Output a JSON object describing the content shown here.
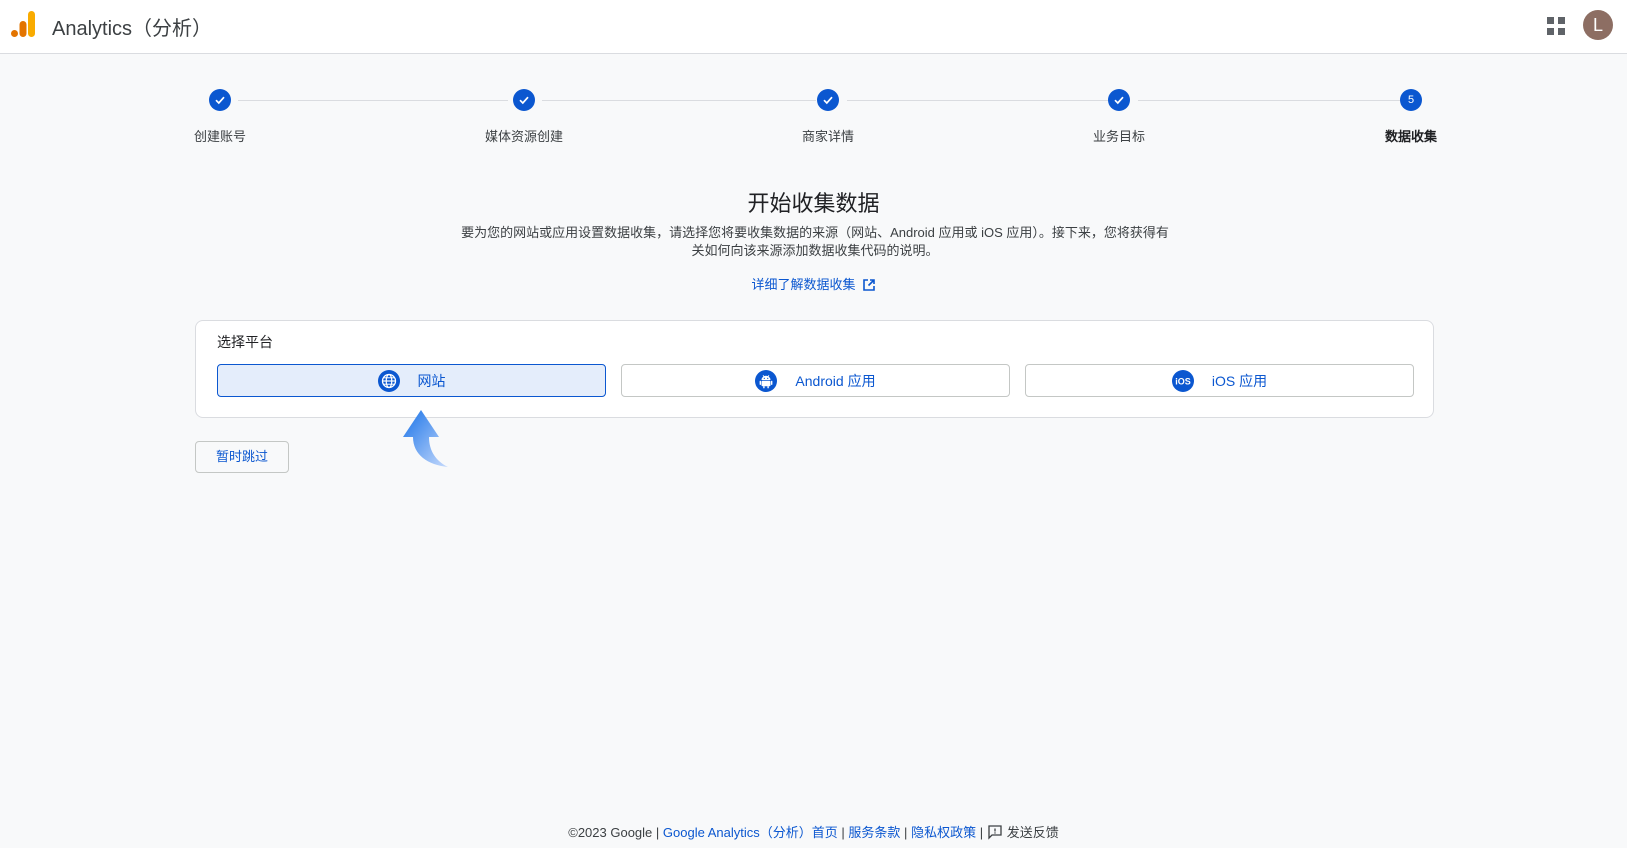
{
  "header": {
    "app_title": "Analytics（分析）",
    "avatar_initial": "L",
    "brand_colors": {
      "bar_orange": "#f9ab00",
      "bar_dark_orange": "#e37400"
    }
  },
  "stepper": {
    "steps": [
      {
        "label": "创建账号",
        "status": "done"
      },
      {
        "label": "媒体资源创建",
        "status": "done"
      },
      {
        "label": "商家详情",
        "status": "done"
      },
      {
        "label": "业务目标",
        "status": "done"
      },
      {
        "label": "数据收集",
        "status": "active",
        "number": "5"
      }
    ]
  },
  "main": {
    "heading": "开始收集数据",
    "description": "要为您的网站或应用设置数据收集，请选择您将要收集数据的来源（网站、Android 应用或 iOS 应用）。接下来，您将获得有关如何向该来源添加数据收集代码的说明。",
    "learn_more": "详细了解数据收集",
    "platform_card": {
      "title": "选择平台",
      "options": [
        {
          "label": "网站",
          "icon": "globe-icon",
          "selected": true
        },
        {
          "label": "Android 应用",
          "icon": "android-icon",
          "selected": false
        },
        {
          "label": "iOS 应用",
          "icon": "ios-icon",
          "icon_text": "iOS",
          "selected": false
        }
      ]
    },
    "skip_label": "暂时跳过"
  },
  "footer": {
    "copyright": "©2023 Google",
    "home_link": "Google Analytics（分析）首页",
    "terms_link": "服务条款",
    "privacy_link": "隐私权政策",
    "separator": "|",
    "feedback": "发送反馈"
  },
  "colors": {
    "accent": "#0b57d0",
    "selected_bg": "#e4edfb",
    "page_bg": "#f8f9fa"
  }
}
